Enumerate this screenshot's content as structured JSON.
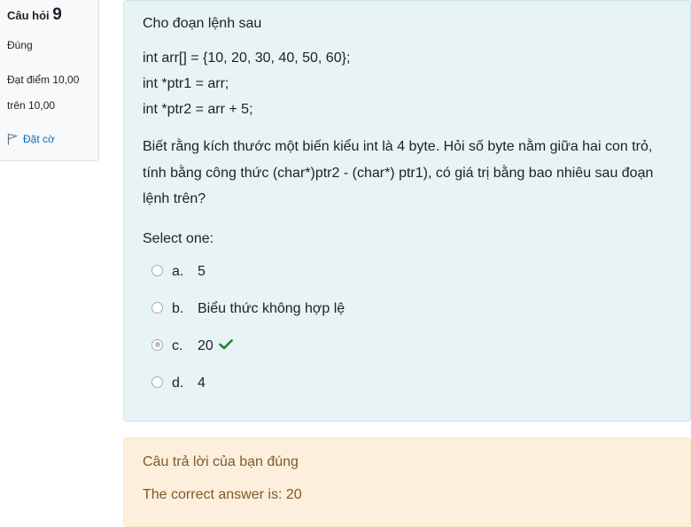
{
  "info": {
    "question_label": "Câu hỏi",
    "question_number": "9",
    "state": "Đúng",
    "grade_line1": "Đạt điểm 10,00",
    "grade_line2": "trên 10,00",
    "flag_label": "Đặt cờ",
    "flag_icon": "flag-icon"
  },
  "question": {
    "title": "Cho đoạn lệnh sau",
    "code": [
      "int arr[] = {10, 20, 30, 40, 50, 60};",
      "int *ptr1 = arr;",
      "int *ptr2 = arr + 5;"
    ],
    "description": "Biết rằng kích thước một biến kiểu int là 4 byte. Hỏi số byte nằm giữa hai con trỏ, tính bằng công thức  (char*)ptr2 - (char*) ptr1), có giá trị bằng bao nhiêu sau đoạn lệnh trên?",
    "prompt": "Select one:",
    "options": [
      {
        "letter": "a.",
        "text": "5",
        "selected": false
      },
      {
        "letter": "b.",
        "text": "Biểu thức không hợp lệ",
        "selected": false
      },
      {
        "letter": "c.",
        "text": "20",
        "selected": true,
        "correct_icon": "check-icon"
      },
      {
        "letter": "d.",
        "text": "4",
        "selected": false
      }
    ]
  },
  "feedback": {
    "message": "Câu trả lời của bạn đúng",
    "right_answer": "The correct answer is: 20"
  },
  "colors": {
    "formulation_bg": "#e7f3f5",
    "feedback_bg": "#fcefdc",
    "feedback_text": "#7d5a29",
    "link": "#0f6cbf",
    "correct": "#1b8a2c"
  }
}
